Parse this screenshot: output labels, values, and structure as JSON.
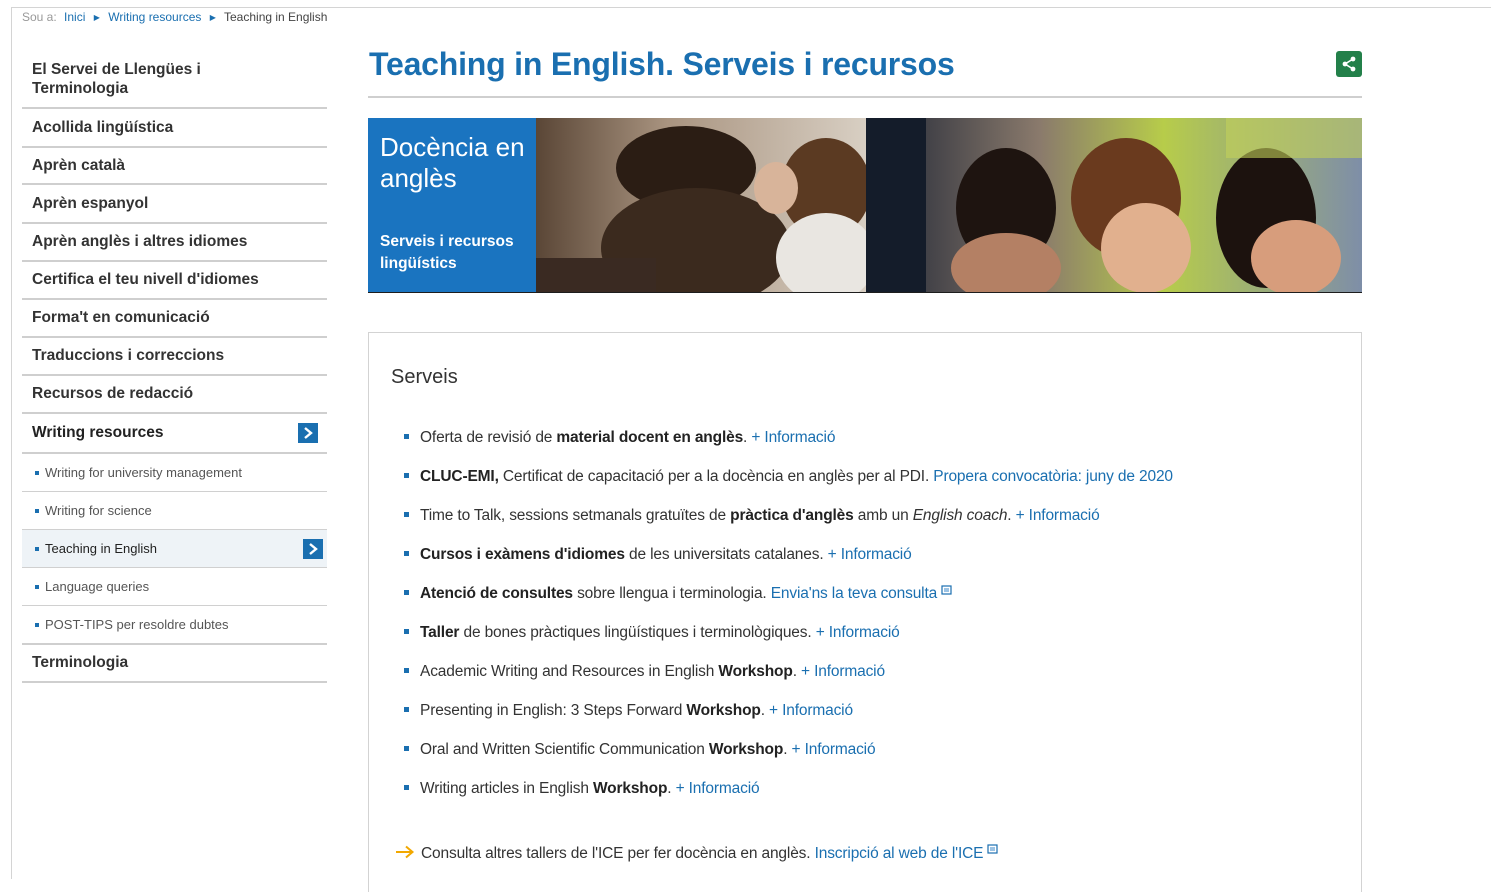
{
  "breadcrumb": {
    "prefix": "Sou a:",
    "items": [
      "Inici",
      "Writing resources"
    ],
    "current": "Teaching in English"
  },
  "sidebar": {
    "items": [
      {
        "label": "El Servei de Llengües i Terminologia"
      },
      {
        "label": "Acollida lingüística"
      },
      {
        "label": "Aprèn català"
      },
      {
        "label": "Aprèn espanyol"
      },
      {
        "label": "Aprèn anglès i altres idiomes"
      },
      {
        "label": "Certifica el teu nivell d'idiomes"
      },
      {
        "label": "Forma't en comunicació"
      },
      {
        "label": "Traduccions i correccions"
      },
      {
        "label": "Recursos de redacció"
      },
      {
        "label": "Writing resources"
      },
      {
        "label": "Writing for university management"
      },
      {
        "label": "Writing for science"
      },
      {
        "label": "Teaching in English"
      },
      {
        "label": "Language queries"
      },
      {
        "label": "POST-TIPS per resoldre dubtes"
      },
      {
        "label": "Terminologia"
      }
    ]
  },
  "main": {
    "title": "Teaching in English. Serveis i recursos",
    "banner": {
      "title": "Docència en anglès",
      "subtitle": "Serveis i recursos lingüístics"
    },
    "services": {
      "heading": "Serveis",
      "items": [
        {
          "t1": "Oferta de revisió de ",
          "b1": "material docent en anglès",
          "t2": ". ",
          "link": "+ Informació"
        },
        {
          "b1": "CLUC-EMI,",
          "t1": " Certificat de capacitació per a la docència en anglès per al PDI. ",
          "link": "Propera convocatòria: juny de 2020"
        },
        {
          "t1": "Time to Talk, sessions setmanals gratuïtes de ",
          "b1": "pràctica d'anglès",
          "t2": " amb un ",
          "i1": "English coach",
          "t3": ". ",
          "link": "+ Informació"
        },
        {
          "b1": "Cursos i exàmens d'idiomes",
          "t1": " de les universitats catalanes. ",
          "link": "+ Informació"
        },
        {
          "b1": "Atenció de consultes",
          "t1": " sobre llengua i terminologia. ",
          "link": "Envia'ns la teva consulta"
        },
        {
          "b1": "Taller",
          "t1": " de bones pràctiques lingüístiques i terminològiques. ",
          "link": "+ Informació"
        },
        {
          "t1": "Academic Writing and Resources in English ",
          "b1": "Workshop",
          "t2": ". ",
          "link": "+ Informació"
        },
        {
          "t1": "Presenting in English: 3 Steps Forward ",
          "b1": "Workshop",
          "t2": ". ",
          "link": "+ Informació"
        },
        {
          "t1": "Oral and Written Scientific Communication ",
          "b1": "Workshop",
          "t2": ". ",
          "link": "+ Informació"
        },
        {
          "t1": "Writing articles in English ",
          "b1": "Workshop",
          "t2": ". ",
          "link": "+ Informació"
        }
      ],
      "ice": {
        "text": "Consulta altres tallers de l'ICE per fer docència en anglès. ",
        "link": "Inscripció al web de l'ICE"
      }
    }
  },
  "colors": {
    "brand_blue": "#1a6fb0",
    "share_green": "#23804a",
    "banner_blue": "#1a74c0"
  }
}
